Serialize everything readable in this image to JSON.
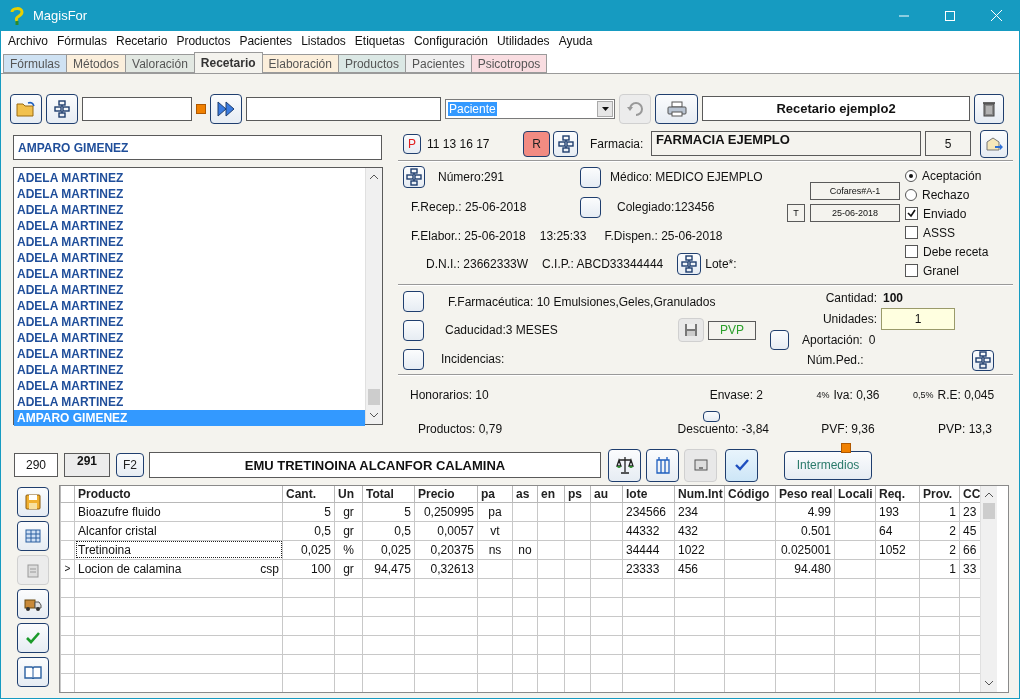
{
  "window": {
    "title": "MagisFor"
  },
  "menu": [
    "Archivo",
    "Fórmulas",
    "Recetario",
    "Productos",
    "Pacientes",
    "Listados",
    "Etiquetas",
    "Configuración",
    "Utilidades",
    "Ayuda"
  ],
  "tabs": [
    {
      "label": "Fórmulas",
      "selected": false,
      "color": "#cfe2f3"
    },
    {
      "label": "Métodos",
      "selected": false,
      "color": "#fbefdc"
    },
    {
      "label": "Valoración",
      "selected": false,
      "color": "#e2e8e2"
    },
    {
      "label": "Recetario",
      "selected": true,
      "color": "#f4f3ee"
    },
    {
      "label": "Elaboración",
      "selected": false,
      "color": "#fcefdb"
    },
    {
      "label": "Productos",
      "selected": false,
      "color": "#dbe8e5"
    },
    {
      "label": "Pacientes",
      "selected": false,
      "color": "#efefef"
    },
    {
      "label": "Psicotropos",
      "selected": false,
      "color": "#f9dde1"
    }
  ],
  "toolbar": {
    "search_type": "Paciente",
    "recipe_title": "Recetario ejemplo2"
  },
  "patient_search": "AMPARO GIMENEZ",
  "patients": [
    {
      "name": "ADELA MARTINEZ",
      "selected": false
    },
    {
      "name": "ADELA MARTINEZ",
      "selected": false
    },
    {
      "name": "ADELA MARTINEZ",
      "selected": false
    },
    {
      "name": "ADELA MARTINEZ",
      "selected": false
    },
    {
      "name": "ADELA MARTINEZ",
      "selected": false
    },
    {
      "name": "ADELA MARTINEZ",
      "selected": false
    },
    {
      "name": "ADELA MARTINEZ",
      "selected": false
    },
    {
      "name": "ADELA MARTINEZ",
      "selected": false
    },
    {
      "name": "ADELA MARTINEZ",
      "selected": false
    },
    {
      "name": "ADELA MARTINEZ",
      "selected": false
    },
    {
      "name": "ADELA MARTINEZ",
      "selected": false
    },
    {
      "name": "ADELA MARTINEZ",
      "selected": false
    },
    {
      "name": "ADELA MARTINEZ",
      "selected": false
    },
    {
      "name": "ADELA MARTINEZ",
      "selected": false
    },
    {
      "name": "ADELA MARTINEZ",
      "selected": false
    },
    {
      "name": "AMPARO GIMENEZ",
      "selected": true
    }
  ],
  "header": {
    "p_button": "P",
    "codes": "11 13 16 17",
    "r_button": "R",
    "pharmacy_label": "Farmacia:",
    "pharmacy": "FARMACIA EJEMPLO",
    "pharmacy_count": "5"
  },
  "details": {
    "numero": "Número:291",
    "medico": "Médico: MEDICO EJEMPLO",
    "f_recep": "F.Recep.: 25-06-2018",
    "colegiado": "Colegiado:123456",
    "f_elabor": "F.Elabor.: 25-06-2018",
    "time": "13:25:33",
    "f_dispen": "F.Dispen.: 25-06-2018",
    "dni": "D.N.I.: 23662333W",
    "cip": "C.I.P.: ABCD33344444",
    "lote": "Lote*:",
    "supplier": "Cofares#A-1",
    "t_button": "T",
    "sent_date": "25-06-2018"
  },
  "decision": [
    {
      "label": "Aceptación",
      "selected": true
    },
    {
      "label": "Rechazo",
      "selected": false
    }
  ],
  "flags": [
    {
      "label": "Enviado",
      "checked": true
    },
    {
      "label": "ASSS",
      "checked": false
    },
    {
      "label": "Debe receta",
      "checked": false
    },
    {
      "label": "Granel",
      "checked": false
    }
  ],
  "preparation": {
    "forma": "F.Farmacéutica: 10 Emulsiones,Geles,Granulados",
    "caducidad": "Caducidad:3 MESES",
    "incidencias": "Incidencias:",
    "price_button": "PVP",
    "cantidad_label": "Cantidad:",
    "cantidad": "100",
    "unidades_label": "Unidades:",
    "unidades": "1",
    "aportacion_label": "Aportación:",
    "aportacion": "0",
    "num_ped_label": "Núm.Ped.:"
  },
  "totals": {
    "honorarios": "Honorarios: 10",
    "envase": "Envase: 2",
    "iva_rate": "4%",
    "iva": "Iva: 0,36",
    "re_rate": "0,5%",
    "re": "R.E: 0,045",
    "productos": "Productos: 0,79",
    "descuento": "Descuento: -3,84",
    "pvf": "PVF: 9,36",
    "pvp": "PVP: 13,3"
  },
  "formula": {
    "previous": "290",
    "current": "291",
    "key_button": "F2",
    "name": "EMU TRETINOINA ALCANFOR CALAMINA",
    "intermediates_button": "Intermedios"
  },
  "table": {
    "columns": [
      "Producto",
      "Cant.",
      "Un",
      "Total",
      "Precio",
      "pa",
      "as",
      "en",
      "ps",
      "au",
      "lote",
      "Num.Int",
      "Código",
      "Peso real",
      "Locali",
      "Req.",
      "Prov.",
      "CC"
    ],
    "rows": [
      {
        "focused": false,
        "cells": [
          "Bioazufre fluido",
          "5",
          "gr",
          "5",
          "0,250995",
          "pa",
          null,
          null,
          null,
          null,
          "234566",
          "234",
          null,
          "4.99",
          null,
          "193",
          "1",
          "23"
        ]
      },
      {
        "focused": false,
        "cells": [
          "Alcanfor cristal",
          "0,5",
          "gr",
          "0,5",
          "0,0057",
          "vt",
          null,
          null,
          null,
          null,
          "44332",
          "432",
          null,
          "0.501",
          null,
          "64",
          "2",
          "45"
        ]
      },
      {
        "focused": true,
        "cells": [
          "Tretinoina",
          "0,025",
          "%",
          "0,025",
          "0,20375",
          "ns",
          "no",
          null,
          null,
          null,
          "34444",
          "1022",
          null,
          "0.025001",
          null,
          "1052",
          "2",
          "66"
        ]
      },
      {
        "focused": false,
        "marker": ">",
        "suffix": "csp",
        "cells": [
          "Locion de calamina",
          "100",
          "gr",
          "94,475",
          "0,32613",
          null,
          null,
          null,
          null,
          null,
          "23333",
          "456",
          null,
          "94.480",
          null,
          null,
          "1",
          "33"
        ]
      }
    ]
  }
}
